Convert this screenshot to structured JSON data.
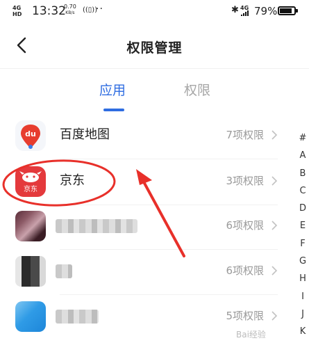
{
  "status_bar": {
    "network": "4G",
    "network_sub": "HD",
    "time": "13:32",
    "speed_value": "0.70",
    "speed_unit": "KB/s",
    "dots": "··",
    "signal_label": "4G",
    "battery_percent": "79%",
    "battery_level": 0.79
  },
  "header": {
    "title": "权限管理"
  },
  "tabs": [
    {
      "label": "应用",
      "active": true
    },
    {
      "label": "权限",
      "active": false
    }
  ],
  "apps": [
    {
      "name": "百度地图",
      "permissions": "7项权限",
      "icon": "baidu-maps-icon"
    },
    {
      "name": "京东",
      "permissions": "3项权限",
      "icon": "jd-icon",
      "icon_label": "京东"
    },
    {
      "name": "",
      "permissions": "6项权限",
      "icon": "blurred-app-icon"
    },
    {
      "name": "",
      "permissions": "6项权限",
      "icon": "blurred-app-icon"
    },
    {
      "name": "",
      "permissions": "5项权限",
      "icon": "blurred-app-icon"
    }
  ],
  "index_letters": [
    "#",
    "A",
    "B",
    "C",
    "D",
    "E",
    "F",
    "G",
    "H",
    "I",
    "J",
    "K"
  ],
  "colors": {
    "accent": "#2f6de1",
    "annotation_red": "#e8302a"
  },
  "watermark": "Bai经验"
}
